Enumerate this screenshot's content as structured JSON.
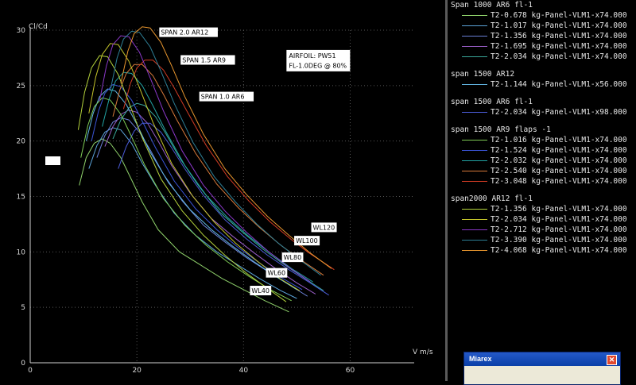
{
  "chart_data": {
    "type": "line",
    "title": "",
    "xlabel": "V m/s",
    "ylabel": "Cl/Cd",
    "xlim": [
      0,
      72
    ],
    "ylim": [
      0,
      30
    ],
    "xticks": [
      "0",
      "20",
      "40",
      "60"
    ],
    "yticks": [
      "0",
      "5",
      "10",
      "15",
      "20",
      "25",
      "30"
    ],
    "grid": true,
    "legend_position": "right",
    "annotations": [
      {
        "text": "SPAN 2.0 AR12",
        "x": 24.5,
        "y": 29.6
      },
      {
        "text": "SPAN 1.5 AR9",
        "x": 28.5,
        "y": 27.1
      },
      {
        "text": "SPAN 1.0 AR6",
        "x": 32,
        "y": 23.8
      },
      {
        "text": "AIRFOIL: PW51",
        "x": 48.5,
        "y": 27.5
      },
      {
        "text": "FL-1.0DEG @ 80%",
        "x": 48.5,
        "y": 26.6
      },
      {
        "text": "WL120",
        "x": 53,
        "y": 12
      },
      {
        "text": "WL100",
        "x": 49.8,
        "y": 10.8
      },
      {
        "text": "WL80",
        "x": 47.5,
        "y": 9.3
      },
      {
        "text": "WL60",
        "x": 44.5,
        "y": 7.9
      },
      {
        "text": "WL40",
        "x": 41.5,
        "y": 6.3
      }
    ],
    "legend_groups": [
      {
        "title": "Span 1000 AR6 fl-1",
        "series": [
          {
            "name": "T2-0.678 kg-Panel-VLM1-x74.000",
            "color": "#8fd16b",
            "x": [
              9.2,
              10.5,
              12,
              13.5,
              15,
              17,
              19,
              21,
              24,
              28,
              32,
              36,
              40,
              44,
              48.5
            ],
            "y": [
              16,
              18.5,
              19.8,
              20.2,
              19.8,
              18.5,
              16.5,
              14.5,
              12,
              10,
              8.8,
              7.6,
              6.6,
              5.6,
              4.6
            ]
          },
          {
            "name": "T2-1.017 kg-Panel-VLM1-x74.000",
            "color": "#5ba3d9",
            "x": [
              11,
              12.5,
              14,
              15.5,
              17,
              19,
              21,
              23.5,
              27,
              31,
              35,
              39,
              43,
              47,
              50
            ],
            "y": [
              17.5,
              19.6,
              20.8,
              21.2,
              21,
              19.8,
              18,
              16,
              13.5,
              11.5,
              10,
              8.8,
              7.6,
              6.5,
              5.8
            ]
          },
          {
            "name": "T2-1.356 kg-Panel-VLM1-x74.000",
            "color": "#6a7fd6",
            "x": [
              12.5,
              14,
              15.5,
              17,
              18.5,
              20.5,
              22.5,
              25,
              28.5,
              32.5,
              36.5,
              40.5,
              45,
              49,
              52
            ],
            "y": [
              18.5,
              20.5,
              21.7,
              22.1,
              21.9,
              20.8,
              19.2,
              17,
              14.6,
              12.4,
              10.9,
              9.5,
              8.1,
              6.9,
              6
            ]
          },
          {
            "name": "T2-1.695 kg-Panel-VLM1-x74.000",
            "color": "#9a5ec9",
            "x": [
              14,
              15.5,
              17,
              18.5,
              20,
              22,
              24,
              26.5,
              30,
              34,
              38,
              42,
              46,
              50,
              53.5
            ],
            "y": [
              19.5,
              21.3,
              22.4,
              22.8,
              22.6,
              21.6,
              20,
              17.8,
              15.3,
              13,
              11.4,
              9.9,
              8.5,
              7.2,
              6.2
            ]
          },
          {
            "name": "T2-2.034 kg-Panel-VLM1-x74.000",
            "color": "#3aa89a",
            "x": [
              15.5,
              17,
              18.5,
              20,
              21.5,
              23.5,
              25.5,
              28,
              31.5,
              35.5,
              39.5,
              43.5,
              47.5,
              51.5,
              55
            ],
            "y": [
              20.2,
              21.9,
              23,
              23.4,
              23.2,
              22.2,
              20.6,
              18.5,
              16,
              13.6,
              11.9,
              10.3,
              8.9,
              7.6,
              6.5
            ]
          }
        ]
      },
      {
        "title": "span 1500 AR12",
        "series": [
          {
            "name": "T2-1.144 kg-Panel-VLM1-x56.000",
            "color": "#63b8e6",
            "x": [
              10.5,
              11.8,
              13,
              14.5,
              16,
              18,
              20,
              22.5,
              26,
              30,
              34,
              38,
              42,
              46,
              50
            ],
            "y": [
              20,
              22.5,
              24,
              24.7,
              24.5,
              23.3,
              21.5,
              19,
              16.2,
              13.8,
              12,
              10.5,
              9.1,
              7.8,
              6.6
            ]
          }
        ]
      },
      {
        "title": "span 1500 AR6 fl-1",
        "series": [
          {
            "name": "T2-2.034 kg-Panel-VLM1-x98.000",
            "color": "#4a5bd6",
            "x": [
              16.5,
              18,
              19.5,
              21,
              22.5,
              24.5,
              26.5,
              29,
              32.5,
              36.5,
              40.5,
              44.5,
              48.5,
              52.5,
              56
            ],
            "y": [
              17.5,
              19.5,
              20.9,
              21.6,
              21.6,
              20.8,
              19.4,
              17.5,
              15.1,
              12.9,
              11.2,
              9.7,
              8.4,
              7.2,
              6.1
            ]
          }
        ]
      },
      {
        "title": "span 1500 AR9 flaps -1",
        "series": [
          {
            "name": "T2-1.016 kg-Panel-VLM1-x74.000",
            "color": "#7fcc55",
            "x": [
              9.5,
              10.8,
              12,
              13.5,
              15,
              17,
              19,
              21.5,
              25,
              29,
              33,
              37,
              41,
              45,
              49
            ],
            "y": [
              18.5,
              21.4,
              23.1,
              23.9,
              23.7,
              22.4,
              20.4,
              17.8,
              14.8,
              12.4,
              10.6,
              9.1,
              7.8,
              6.6,
              5.6
            ]
          },
          {
            "name": "T2-1.524 kg-Panel-VLM1-x74.000",
            "color": "#3b55d9",
            "x": [
              11.5,
              12.8,
              14,
              15.5,
              17,
              19,
              21,
              23.5,
              27,
              31,
              35,
              39,
              43,
              47,
              51
            ],
            "y": [
              20,
              22.7,
              24.3,
              25.1,
              24.9,
              23.7,
              21.8,
              19.4,
              16.4,
              13.9,
              12,
              10.4,
              9,
              7.7,
              6.6
            ]
          },
          {
            "name": "T2-2.032 kg-Panel-VLM1-x74.000",
            "color": "#22a3a3",
            "x": [
              13.5,
              14.8,
              16,
              17.5,
              19,
              21,
              23,
              25.5,
              29,
              33,
              37,
              41,
              45,
              49,
              53
            ],
            "y": [
              21.3,
              23.8,
              25.4,
              26.2,
              26.1,
              25,
              23.2,
              20.8,
              17.8,
              15.1,
              13.1,
              11.4,
              9.9,
              8.5,
              7.3
            ]
          },
          {
            "name": "T2-2.540 kg-Panel-VLM1-x74.000",
            "color": "#d87a3a",
            "x": [
              15.5,
              16.8,
              18,
              19.5,
              21,
              23,
              25,
              27.5,
              31,
              35,
              39,
              43,
              47,
              51,
              55
            ],
            "y": [
              22.2,
              24.6,
              26.1,
              26.9,
              26.9,
              25.9,
              24.2,
              21.9,
              18.9,
              16.1,
              14,
              12.2,
              10.6,
              9.2,
              7.9
            ]
          },
          {
            "name": "T2-3.048 kg-Panel-VLM1-x74.000",
            "color": "#d23c24",
            "x": [
              17.5,
              18.8,
              20,
              21.5,
              23,
              25,
              27,
              29.5,
              33,
              37,
              41,
              45,
              49,
              52,
              57
            ],
            "y": [
              22.9,
              25.2,
              26.6,
              27.3,
              27.3,
              26.4,
              24.8,
              22.6,
              19.6,
              16.8,
              14.6,
              12.7,
              11.1,
              10,
              8.4
            ]
          }
        ]
      },
      {
        "title": "span2000 AR12 fl-1",
        "series": [
          {
            "name": "T2-1.356 kg-Panel-VLM1-x74.000",
            "color": "#b4d23c",
            "x": [
              9,
              10.2,
              11.5,
              13,
              14.5,
              16.5,
              18.5,
              21,
              24.5,
              28.5,
              32.5,
              36.5,
              40.5,
              44.5,
              48
            ],
            "y": [
              21,
              24.4,
              26.6,
              27.7,
              27.6,
              26,
              23.5,
              20.3,
              16.6,
              13.7,
              11.5,
              9.7,
              8.1,
              6.7,
              5.5
            ]
          },
          {
            "name": "T2-2.034 kg-Panel-VLM1-x74.000",
            "color": "#c5c52a",
            "x": [
              11,
              12.3,
              13.5,
              15,
              16.5,
              18.5,
              20.5,
              23,
              26.5,
              30.5,
              34.5,
              38.5,
              42.5,
              46.5,
              50.5
            ],
            "y": [
              22.5,
              25.8,
              27.8,
              28.8,
              28.7,
              27.2,
              24.8,
              21.7,
              18,
              15,
              12.7,
              10.8,
              9.2,
              7.7,
              6.5
            ]
          },
          {
            "name": "T2-2.712 kg-Panel-VLM1-x74.000",
            "color": "#8a38c8",
            "x": [
              13,
              14.3,
              15.5,
              17,
              18.5,
              20.5,
              22.5,
              25,
              28.5,
              32.5,
              36.5,
              40.5,
              44.5,
              48.5,
              52.5
            ],
            "y": [
              23.6,
              26.8,
              28.7,
              29.5,
              29.4,
              28,
              25.7,
              22.7,
              19.1,
              16,
              13.7,
              11.8,
              10.1,
              8.6,
              7.3
            ]
          },
          {
            "name": "T2-3.390 kg-Panel-VLM1-x74.000",
            "color": "#2e7f96",
            "x": [
              15,
              16.3,
              17.5,
              19,
              20.5,
              22.5,
              24.5,
              27,
              30.5,
              34.5,
              38.5,
              42.5,
              46.5,
              50.5,
              54.5
            ],
            "y": [
              24.5,
              27.5,
              29.2,
              29.9,
              29.8,
              28.5,
              26.3,
              23.4,
              19.9,
              16.8,
              14.5,
              12.5,
              10.8,
              9.3,
              7.9
            ]
          },
          {
            "name": "T2-4.068 kg-Panel-VLM1-x74.000",
            "color": "#e8962e",
            "x": [
              17,
              18.3,
              19.5,
              21,
              22.5,
              24.5,
              26.5,
              29,
              32.5,
              36.5,
              40.5,
              44.5,
              48.5,
              52.5,
              56.5
            ],
            "y": [
              25.2,
              28.1,
              29.7,
              30.3,
              30.2,
              28.9,
              26.8,
              24,
              20.6,
              17.5,
              15.2,
              13.2,
              11.5,
              9.9,
              8.5
            ]
          }
        ]
      }
    ]
  },
  "window": {
    "title": "Miarex",
    "close_glyph": "✕"
  }
}
